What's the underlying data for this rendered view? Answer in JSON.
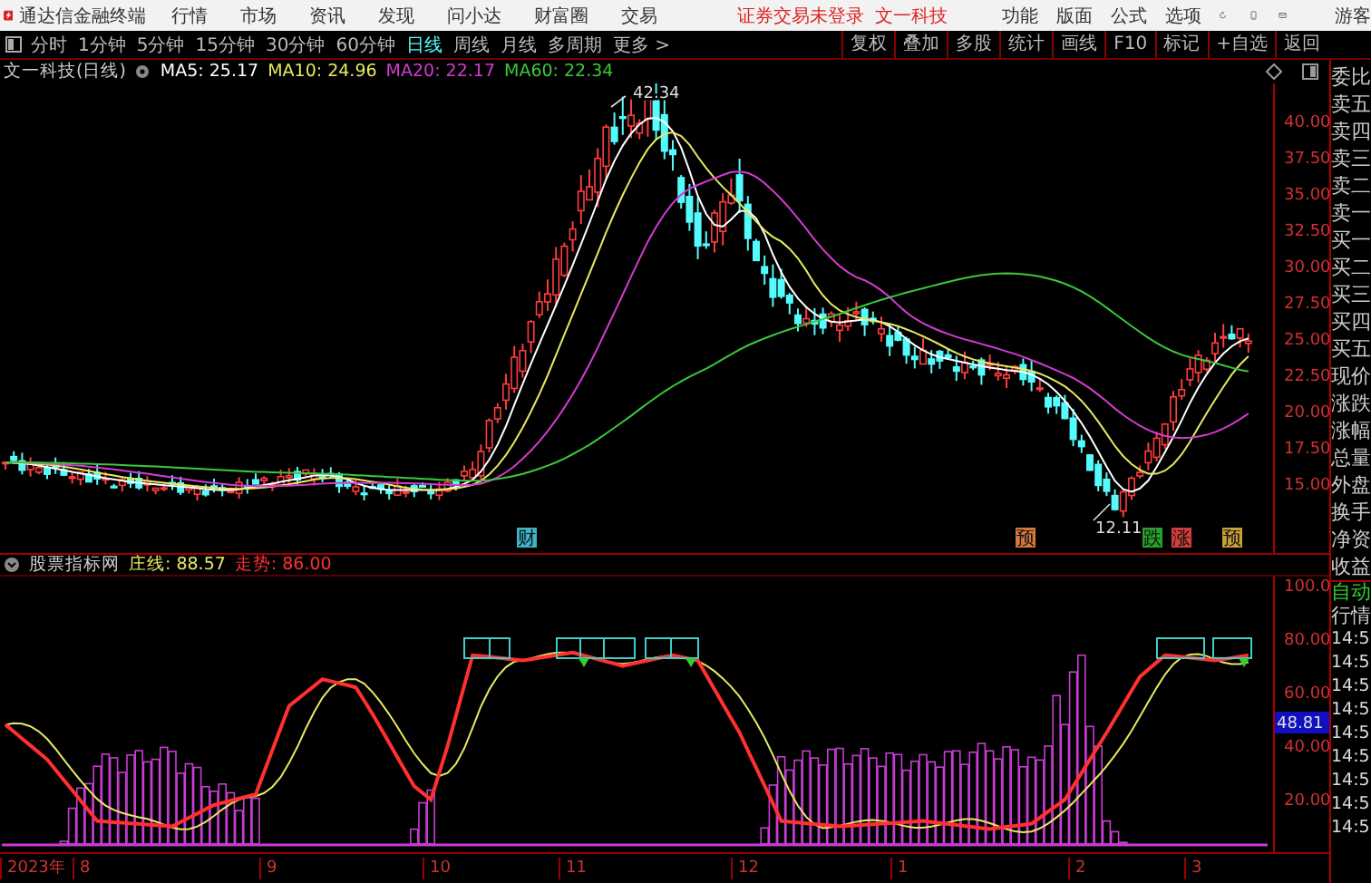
{
  "title_bar": {
    "app_name": "通达信金融终端",
    "menu": [
      "行情",
      "市场",
      "资讯",
      "发现",
      "问小达",
      "财富圈",
      "交易"
    ],
    "status": "证券交易未登录",
    "stock": "文一科技",
    "actions": [
      "功能",
      "版面",
      "公式",
      "选项"
    ],
    "user": "游客"
  },
  "period_tabs": [
    {
      "label": "分时",
      "selected": false
    },
    {
      "label": "1分钟",
      "selected": false
    },
    {
      "label": "5分钟",
      "selected": false
    },
    {
      "label": "15分钟",
      "selected": false
    },
    {
      "label": "30分钟",
      "selected": false
    },
    {
      "label": "60分钟",
      "selected": false
    },
    {
      "label": "日线",
      "selected": true
    },
    {
      "label": "周线",
      "selected": false
    },
    {
      "label": "月线",
      "selected": false
    },
    {
      "label": "多周期",
      "selected": false
    },
    {
      "label": "更多 >",
      "selected": false
    }
  ],
  "tools": [
    "复权",
    "叠加",
    "多股",
    "统计",
    "画线",
    "F10",
    "标记",
    "+自选",
    "返回"
  ],
  "price_chart": {
    "title": "文一科技(日线)",
    "ma": [
      {
        "label": "MA5: 25.17",
        "color": "#ffffff"
      },
      {
        "label": "MA10: 24.96",
        "color": "#e8e860"
      },
      {
        "label": "MA20: 22.17",
        "color": "#d23cd2"
      },
      {
        "label": "MA60: 22.34",
        "color": "#3cc83c"
      }
    ],
    "high_label": "42.34",
    "low_label": "12.11",
    "axis_labels": [
      "40.00",
      "37.50",
      "35.00",
      "32.50",
      "30.00",
      "27.50",
      "25.00",
      "22.50",
      "20.00",
      "17.50",
      "15.00"
    ],
    "markers": [
      {
        "label": "财",
        "color": "#3cb4c8"
      },
      {
        "label": "预",
        "color": "#d2783c"
      },
      {
        "label": "跌",
        "color": "#28a028"
      },
      {
        "label": "涨",
        "color": "#d23c3c"
      },
      {
        "label": "预",
        "color": "#c8a03c"
      }
    ]
  },
  "indicator": {
    "name": "股票指标网",
    "lines": [
      {
        "label": "庄线: 88.57",
        "color": "#e8e860"
      },
      {
        "label": "走势: 86.00",
        "color": "#ff3030"
      }
    ],
    "axis_labels": [
      "100.0",
      "80.00",
      "60.00",
      "40.00",
      "20.00"
    ],
    "current_value": "48.81"
  },
  "time_axis": [
    "2023年",
    "8",
    "9",
    "10",
    "11",
    "12",
    "1",
    "2",
    "3"
  ],
  "quote_panel": {
    "labels": [
      "委比",
      "卖五",
      "卖四",
      "卖三",
      "卖二",
      "卖一",
      "买一",
      "买二",
      "买三",
      "买四",
      "买五",
      "现价",
      "涨跌",
      "涨幅",
      "总量",
      "外盘",
      "换手",
      "净资",
      "收益"
    ],
    "mode": "自动",
    "section": "行情",
    "times": [
      "14:5",
      "14:5",
      "14:5",
      "14:5",
      "14:5",
      "14:5",
      "14:5",
      "14:5",
      "14:5"
    ]
  }
}
